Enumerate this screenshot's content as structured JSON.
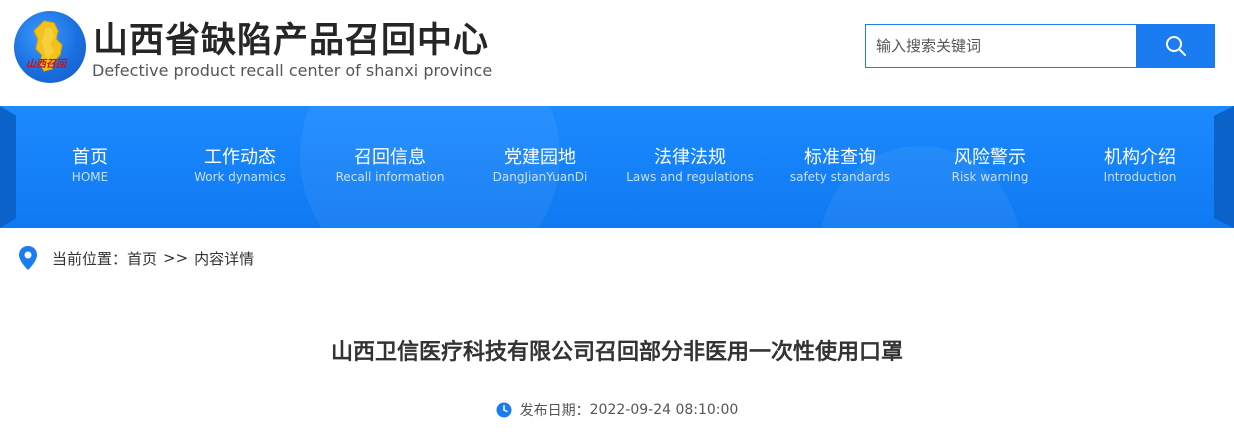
{
  "header": {
    "logo_icon": "shanxi-map-logo",
    "title": "山西省缺陷产品召回中心",
    "subtitle": "Defective product recall center of shanxi province",
    "logo_text": "山西召回"
  },
  "search": {
    "placeholder": "输入搜索关键词",
    "button_icon": "search-icon"
  },
  "nav": {
    "items": [
      {
        "zh": "首页",
        "en": "HOME"
      },
      {
        "zh": "工作动态",
        "en": "Work dynamics"
      },
      {
        "zh": "召回信息",
        "en": "Recall information"
      },
      {
        "zh": "党建园地",
        "en": "DangJianYuanDi"
      },
      {
        "zh": "法律法规",
        "en": "Laws and regulations"
      },
      {
        "zh": "标准查询",
        "en": "safety standards"
      },
      {
        "zh": "风险警示",
        "en": "Risk warning"
      },
      {
        "zh": "机构介绍",
        "en": "Introduction"
      }
    ]
  },
  "breadcrumb": {
    "label": "当前位置：",
    "home": "首页",
    "separator": ">>",
    "current": "内容详情"
  },
  "article": {
    "title": "山西卫信医疗科技有限公司召回部分非医用一次性使用口罩",
    "date_label": "发布日期：",
    "date": "2022-09-24 08:10:00"
  },
  "colors": {
    "accent": "#1a7cf0",
    "nav_bg": "#1484f8",
    "logo_gold": "#f3c21b"
  }
}
